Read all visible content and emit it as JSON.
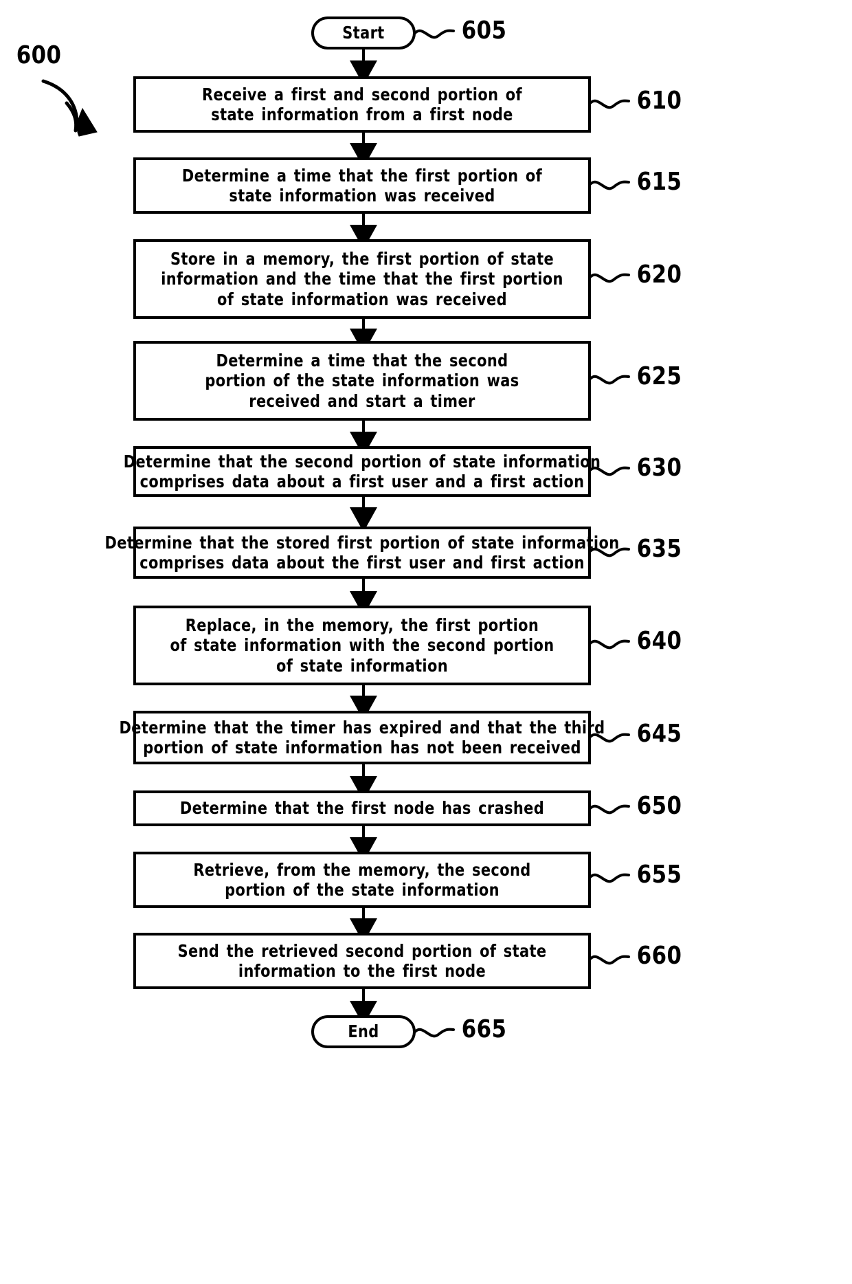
{
  "figure": {
    "label": "600",
    "type": "patent-flowchart"
  },
  "nodes": [
    {
      "id": "start",
      "shape": "terminal",
      "ref": "605",
      "lines": [
        "Start"
      ]
    },
    {
      "id": "step-610",
      "shape": "process",
      "ref": "610",
      "lines": [
        "Receive a first and second portion of",
        "state information from a first node"
      ]
    },
    {
      "id": "step-615",
      "shape": "process",
      "ref": "615",
      "lines": [
        "Determine a time that the first portion of",
        "state information was received"
      ]
    },
    {
      "id": "step-620",
      "shape": "process",
      "ref": "620",
      "lines": [
        "Store in a memory, the first portion of state",
        "information and the time that the first portion",
        "of state information was received"
      ]
    },
    {
      "id": "step-625",
      "shape": "process",
      "ref": "625",
      "lines": [
        "Determine a time that the second",
        "portion of the state information was",
        "received and start a timer"
      ]
    },
    {
      "id": "step-630",
      "shape": "process",
      "ref": "630",
      "lines": [
        "Determine that the second portion of state information",
        "comprises data about a first user and a first action"
      ]
    },
    {
      "id": "step-635",
      "shape": "process",
      "ref": "635",
      "lines": [
        "Determine that the stored first portion of state information",
        "comprises data about the first user and first action"
      ]
    },
    {
      "id": "step-640",
      "shape": "process",
      "ref": "640",
      "lines": [
        "Replace, in the memory, the first portion",
        "of state information with the second portion",
        "of state information"
      ]
    },
    {
      "id": "step-645",
      "shape": "process",
      "ref": "645",
      "lines": [
        "Determine that the timer has expired and that the third",
        "portion of state information has not been received"
      ]
    },
    {
      "id": "step-650",
      "shape": "process",
      "ref": "650",
      "lines": [
        "Determine that the first node has crashed"
      ]
    },
    {
      "id": "step-655",
      "shape": "process",
      "ref": "655",
      "lines": [
        "Retrieve, from the memory, the second",
        "portion of the state information"
      ]
    },
    {
      "id": "step-660",
      "shape": "process",
      "ref": "660",
      "lines": [
        "Send the retrieved second portion of state",
        "information to the first node"
      ]
    },
    {
      "id": "end",
      "shape": "terminal",
      "ref": "665",
      "lines": [
        "End"
      ]
    }
  ],
  "colors": {
    "stroke": "#000000",
    "fill": "#ffffff"
  }
}
